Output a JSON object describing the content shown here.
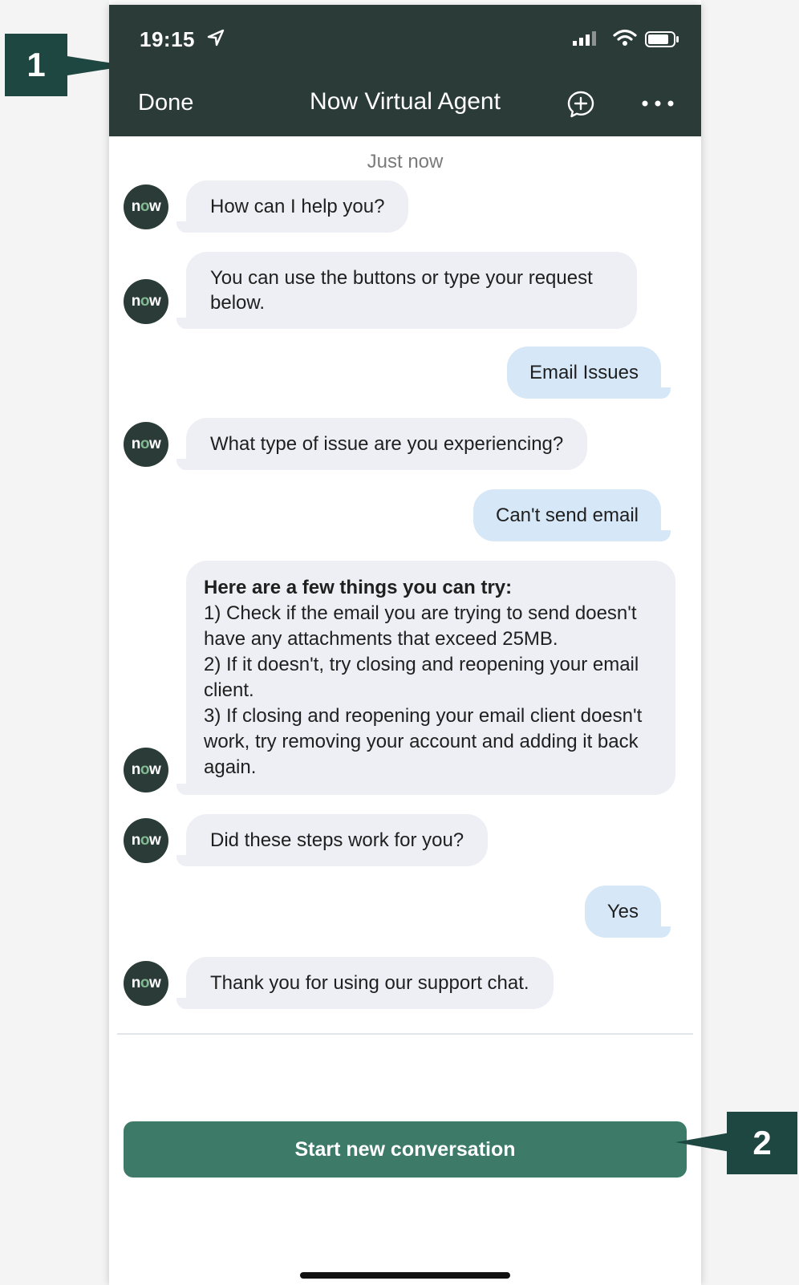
{
  "status_bar": {
    "time": "19:15"
  },
  "header": {
    "done_label": "Done",
    "title": "Now Virtual Agent",
    "new_chat_icon": "chat-plus-icon",
    "more_icon": "ellipsis-icon"
  },
  "chat": {
    "timestamp": "Just now",
    "avatar_text_n": "n",
    "avatar_text_o": "o",
    "avatar_text_w": "w",
    "messages": [
      {
        "from": "bot",
        "text": "How can I help you?"
      },
      {
        "from": "bot",
        "text": "You can use the buttons or type your request below."
      },
      {
        "from": "user",
        "text": "Email Issues"
      },
      {
        "from": "bot",
        "text": "What type of issue are you experiencing?"
      },
      {
        "from": "user",
        "text": "Can't send email"
      },
      {
        "from": "bot",
        "heading": "Here are a few things you can try:",
        "lines": [
          "1) Check if the email you are trying to send doesn't have any attachments that exceed 25MB.",
          "2) If it doesn't, try closing and reopening your email client.",
          "3) If closing and reopening your email client doesn't work, try removing your account and adding it back again."
        ]
      },
      {
        "from": "bot",
        "text": "Did these steps work for you?"
      },
      {
        "from": "user",
        "text": "Yes"
      },
      {
        "from": "bot",
        "text": "Thank you for using our support chat."
      }
    ]
  },
  "footer": {
    "start_button_label": "Start new conversation"
  },
  "callouts": {
    "one": "1",
    "two": "2"
  },
  "colors": {
    "header_bg": "#2b3b37",
    "bot_bubble": "#eeeff4",
    "user_bubble": "#d6e7f7",
    "accent": "#3d7a68",
    "callout_bg": "#1f4741"
  }
}
